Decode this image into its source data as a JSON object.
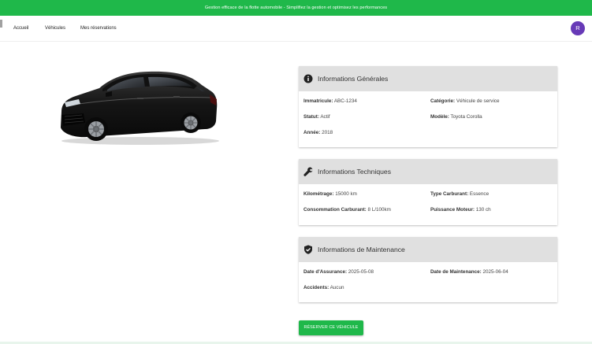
{
  "banner": {
    "text": "Gestion efficace de la flotte automobile - Simplifiez la gestion et optimisez les performances"
  },
  "nav": {
    "items": [
      {
        "label": "Accueil"
      },
      {
        "label": "Véhicules"
      },
      {
        "label": "Mes réservations"
      }
    ],
    "avatar": "R"
  },
  "vehicle_image": {
    "icon": "car-image"
  },
  "general": {
    "title": "Informations Générales",
    "icon": "info-icon",
    "fields": [
      {
        "label": "Immatricule:",
        "value": " ABC-1234"
      },
      {
        "label": "Catégorie:",
        "value": " Véhicule de service"
      },
      {
        "label": "Statut:",
        "value": " Actif"
      },
      {
        "label": "Modèle:",
        "value": " Toyota Corolla"
      },
      {
        "label": "Année:",
        "value": " 2018"
      }
    ]
  },
  "technical": {
    "title": "Informations Techniques",
    "icon": "wrench-icon",
    "fields": [
      {
        "label": "Kilométrage:",
        "value": " 15000 km"
      },
      {
        "label": "Type Carburant:",
        "value": " Essence"
      },
      {
        "label": "Consommation Carburant:",
        "value": " 8 L/100km"
      },
      {
        "label": "Puissance Moteur:",
        "value": " 130 ch"
      }
    ]
  },
  "maintenance": {
    "title": "Informations de Maintenance",
    "icon": "shield-check-icon",
    "fields": [
      {
        "label": "Date d'Assurance:",
        "value": " 2025-05-08"
      },
      {
        "label": "Date de Maintenance:",
        "value": " 2025-06-04"
      },
      {
        "label": "Accidents:",
        "value": " Aucun"
      }
    ]
  },
  "actions": {
    "reserve_label": "RÉSERVER CE VÉHICULE"
  },
  "colors": {
    "accent_green": "#1fb84a",
    "avatar_purple": "#673ab7",
    "card_header_grey": "#e0e0e0"
  }
}
